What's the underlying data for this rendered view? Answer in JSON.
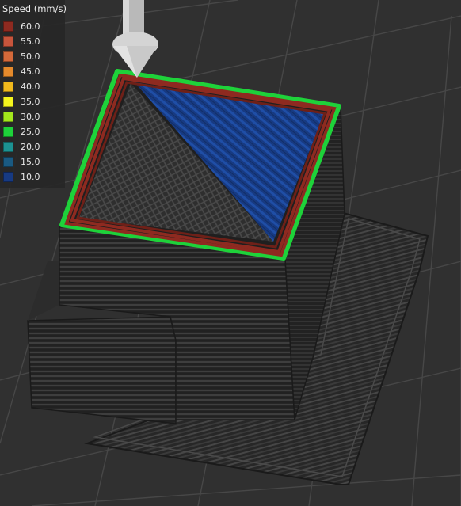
{
  "legend": {
    "title": "Speed (mm/s)",
    "items": [
      {
        "label": "60.0",
        "color": "#8e2a20"
      },
      {
        "label": "55.0",
        "color": "#c8553c"
      },
      {
        "label": "50.0",
        "color": "#d4693a"
      },
      {
        "label": "45.0",
        "color": "#e58a2c"
      },
      {
        "label": "40.0",
        "color": "#f0b81c"
      },
      {
        "label": "35.0",
        "color": "#f4f41e"
      },
      {
        "label": "30.0",
        "color": "#a3e61c"
      },
      {
        "label": "25.0",
        "color": "#1ed23a"
      },
      {
        "label": "20.0",
        "color": "#1c9292"
      },
      {
        "label": "15.0",
        "color": "#1a5a82"
      },
      {
        "label": "10.0",
        "color": "#173a82"
      }
    ]
  },
  "preview": {
    "model": "sliced-box-with-skirt",
    "perimeter_outer_color": "#1ed23a",
    "perimeter_inner_color": "#8e2a20",
    "top_solid_infill_color": "#173a82",
    "sparse_infill_color": "#3a3a3a",
    "bed_background_color": "#303030"
  }
}
